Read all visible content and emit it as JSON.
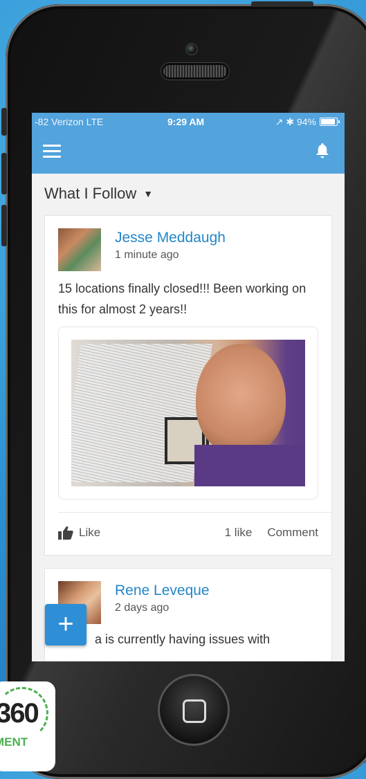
{
  "status": {
    "carrier": "-82 Verizon  LTE",
    "time": "9:29 AM",
    "right": "↗ ✱ 94%"
  },
  "feed": {
    "title": "What I Follow",
    "caret": "▼"
  },
  "posts": [
    {
      "author": "Jesse Meddaugh",
      "time": "1 minute ago",
      "text": "15 locations finally closed!!! Been working on this for almost 2 years!!",
      "like_label": "Like",
      "like_count": "1 like",
      "comment_label": "Comment"
    },
    {
      "author": "Rene Leveque",
      "time": "2 days ago",
      "text_line1": "a is currently having issues with",
      "text_line2": ""
    }
  ],
  "fab_label": "+",
  "logo": {
    "number": "360",
    "word": "MENT"
  },
  "colors": {
    "accent": "#53a3dc",
    "link": "#2486c8",
    "fab": "#2f8fd6"
  }
}
